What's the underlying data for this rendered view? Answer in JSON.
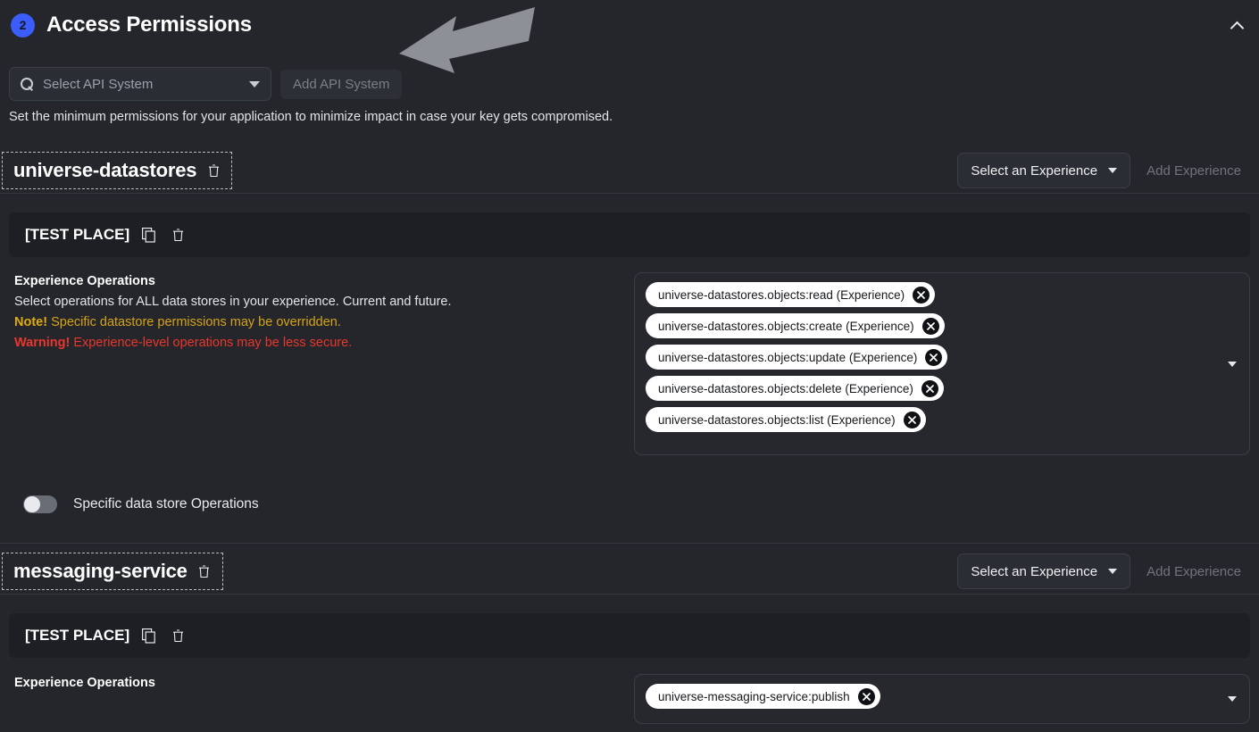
{
  "section": {
    "step_number": "2",
    "title": "Access Permissions",
    "collapse_icon": "chevron-up-icon",
    "accent_color": "#3b5dfc"
  },
  "api_selector": {
    "search_icon": "search-icon",
    "placeholder": "Select API System",
    "dropdown_icon": "chevron-down-icon",
    "add_button_label": "Add API System"
  },
  "hint": "Set the minimum permissions for your application to minimize impact in case your key gets compromised.",
  "annotation": {
    "arrow_icon": "left-arrow-annotation",
    "color": "#8d9097"
  },
  "experience_control": {
    "select_label": "Select an Experience",
    "dropdown_icon": "chevron-down-icon",
    "add_button_label": "Add Experience"
  },
  "services": [
    {
      "name": "universe-datastores",
      "delete_icon": "trash-icon",
      "place": {
        "name": "[TEST PLACE]",
        "copy_icon": "copy-icon",
        "delete_icon": "trash-icon"
      },
      "operations": {
        "title": "Experience Operations",
        "description": "Select operations for ALL data stores in your experience. Current and future.",
        "note_prefix": "Note!",
        "note_text": " Specific datastore permissions may be overridden.",
        "warning_prefix": "Warning!",
        "warning_text": " Experience-level operations may be less secure.",
        "chips": [
          "universe-datastores.objects:read (Experience)",
          "universe-datastores.objects:create (Experience)",
          "universe-datastores.objects:update (Experience)",
          "universe-datastores.objects:delete (Experience)",
          "universe-datastores.objects:list (Experience)"
        ],
        "chip_remove_icon": "close-circle-icon",
        "dropdown_icon": "chevron-down-icon"
      },
      "specific_toggle": {
        "label": "Specific data store Operations",
        "state": "off"
      }
    },
    {
      "name": "messaging-service",
      "delete_icon": "trash-icon",
      "place": {
        "name": "[TEST PLACE]",
        "copy_icon": "copy-icon",
        "delete_icon": "trash-icon"
      },
      "operations": {
        "title": "Experience Operations",
        "chips": [
          "universe-messaging-service:publish"
        ],
        "chip_remove_icon": "close-circle-icon",
        "dropdown_icon": "chevron-down-icon"
      }
    }
  ]
}
